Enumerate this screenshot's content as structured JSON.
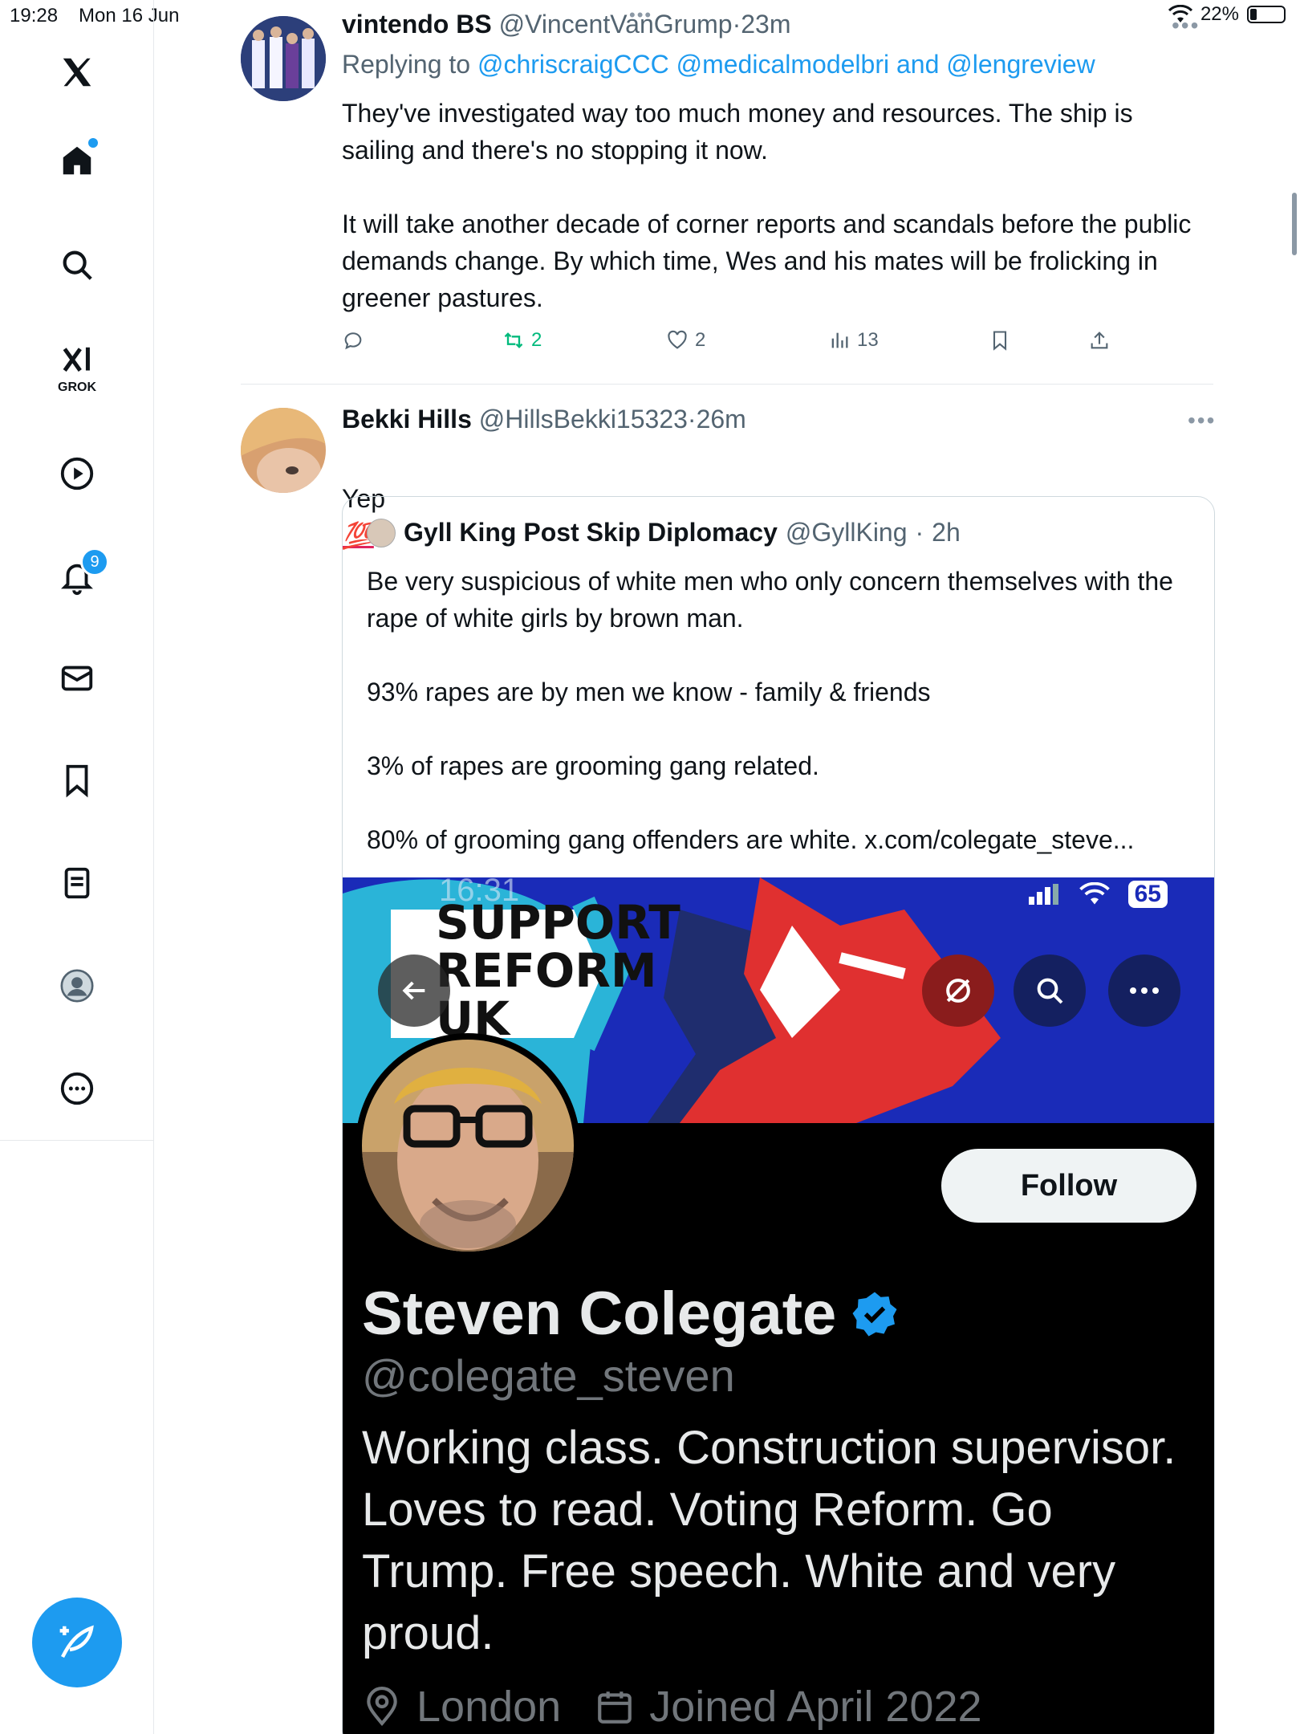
{
  "status_bar": {
    "time": "19:28",
    "date": "Mon 16 Jun",
    "battery": "22%"
  },
  "sidebar": {
    "grok_label": "GROK",
    "notifications_badge": "9",
    "items": [
      "x-logo",
      "home",
      "search",
      "grok",
      "video",
      "notifications",
      "messages",
      "bookmarks",
      "lists",
      "profile",
      "more"
    ]
  },
  "tweet1": {
    "name": "vintendo BS",
    "handle": "@VincentVanGrump",
    "time": "23m",
    "replying_prefix": "Replying to",
    "replying_handles": "@chriscraigCCC @medicalmodelbri",
    "replying_and": "and",
    "replying_last": "@lengreview",
    "text": "They've investigated way too much money and resources. The ship is sailing and there's no stopping it now.\n\nIt will take another decade of corner reports and scandals before the public demands change. By which time, Wes and his mates will be frolicking in greener pastures.",
    "retweets": "2",
    "likes": "2",
    "views": "13",
    "colors": {
      "retweet": "#00ba7c"
    }
  },
  "tweet2": {
    "name": "Bekki Hills",
    "handle": "@HillsBekki15323",
    "time": "26m",
    "text": "Yep",
    "emoji": "💯"
  },
  "quote": {
    "name": "Gyll King Post Skip Diplomacy",
    "handle": "@GyllKing",
    "time": "2h",
    "text": "Be very suspicious of white men who only concern themselves with the rape of white girls by brown man.\n\n93% rapes are by men we know - family & friends\n\n3% of rapes are grooming gang related.\n\n80% of grooming gang offenders are white. x.com/colegate_steve..."
  },
  "embedded_profile": {
    "inner_time": "16:31",
    "inner_battery": "65",
    "banner_line1": "SUPPORT",
    "banner_line2": "REFORM",
    "banner_line3": "UK",
    "follow_label": "Follow",
    "name": "Steven Colegate",
    "handle": "@colegate_steven",
    "bio": "Working class. Construction supervisor. Loves to read. Voting Reform. Go Trump. Free speech. White and very proud.",
    "location": "London",
    "joined": "Joined April 2022",
    "colors": {
      "banner": "#1a2bb8",
      "verified": "#1d9bf0"
    }
  }
}
